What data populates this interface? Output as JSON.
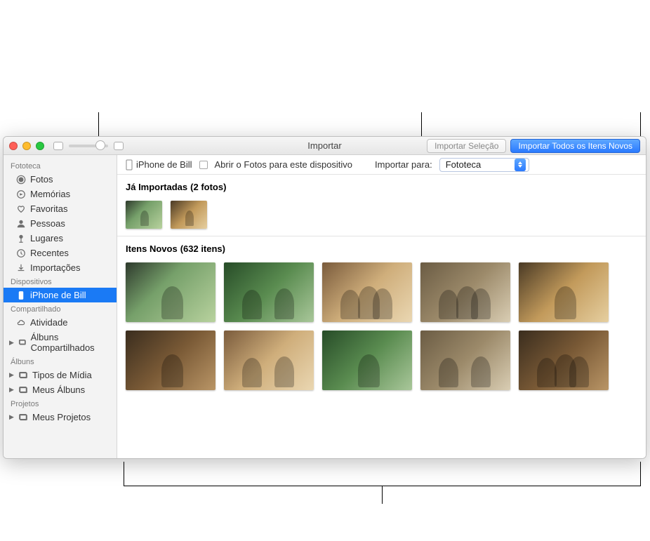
{
  "window": {
    "title": "Importar",
    "toolbar": {
      "import_selection_label": "Importar Seleção",
      "import_all_label": "Importar Todos os Itens Novos"
    }
  },
  "optbar": {
    "device_name": "iPhone de Bill",
    "checkbox_label": "Abrir o Fotos para este dispositivo",
    "import_to_label": "Importar para:",
    "import_to_value": "Fototeca"
  },
  "sidebar": {
    "sections": [
      {
        "header": "Fototeca",
        "items": [
          {
            "label": "Fotos",
            "icon": "photos-icon"
          },
          {
            "label": "Memórias",
            "icon": "memories-icon"
          },
          {
            "label": "Favoritas",
            "icon": "heart-icon"
          },
          {
            "label": "Pessoas",
            "icon": "people-icon"
          },
          {
            "label": "Lugares",
            "icon": "pin-icon"
          },
          {
            "label": "Recentes",
            "icon": "clock-icon"
          },
          {
            "label": "Importações",
            "icon": "import-icon"
          }
        ]
      },
      {
        "header": "Dispositivos",
        "items": [
          {
            "label": "iPhone de Bill",
            "icon": "device-icon",
            "selected": true
          }
        ]
      },
      {
        "header": "Compartilhado",
        "items": [
          {
            "label": "Atividade",
            "icon": "cloud-icon"
          },
          {
            "label": "Álbuns Compartilhados",
            "icon": "album-icon",
            "disclosure": true
          }
        ]
      },
      {
        "header": "Álbuns",
        "items": [
          {
            "label": "Tipos de Mídia",
            "icon": "album-icon",
            "disclosure": true
          },
          {
            "label": "Meus Álbuns",
            "icon": "album-icon",
            "disclosure": true
          }
        ]
      },
      {
        "header": "Projetos",
        "items": [
          {
            "label": "Meus Projetos",
            "icon": "album-icon",
            "disclosure": true
          }
        ]
      }
    ]
  },
  "content": {
    "already_imported_label": "Já Importadas",
    "already_imported_count_text": "(2 fotos)",
    "new_items_label": "Itens Novos",
    "new_items_count_text": "(632 itens)",
    "already_imported_count": 2,
    "new_items_count": 632,
    "new_items_shown": 10
  },
  "colors": {
    "accent": "#1a7af5"
  }
}
